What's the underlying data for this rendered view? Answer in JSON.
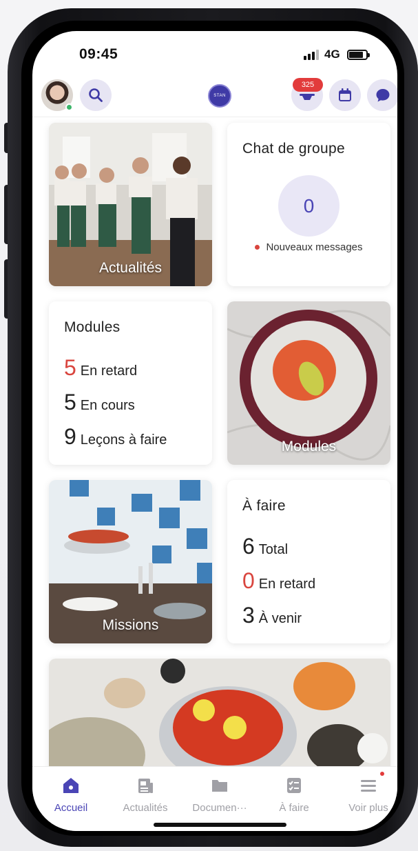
{
  "status_bar": {
    "time": "09:45",
    "network": "4G"
  },
  "header": {
    "notification_count": "325",
    "logo_text": "STAN"
  },
  "cards": {
    "news": {
      "caption": "Actualités"
    },
    "group_chat": {
      "title": "Chat de groupe",
      "count": "0",
      "note": "Nouveaux messages"
    },
    "modules_stats": {
      "title": "Modules",
      "rows": [
        {
          "value": "5",
          "label": "En retard"
        },
        {
          "value": "5",
          "label": "En cours"
        },
        {
          "value": "9",
          "label": "Leçons à faire"
        }
      ]
    },
    "modules_image": {
      "caption": "Modules"
    },
    "missions": {
      "caption": "Missions"
    },
    "todo": {
      "title": "À faire",
      "rows": [
        {
          "value": "6",
          "label": "Total"
        },
        {
          "value": "0",
          "label": "En retard"
        },
        {
          "value": "3",
          "label": "À venir"
        }
      ]
    }
  },
  "bottom_nav": {
    "items": [
      {
        "label": "Accueil",
        "icon": "home-icon"
      },
      {
        "label": "Actualités",
        "icon": "newspaper-icon"
      },
      {
        "label": "Documen···",
        "icon": "folder-icon"
      },
      {
        "label": "À faire",
        "icon": "checklist-icon"
      },
      {
        "label": "Voir plus",
        "icon": "menu-icon"
      }
    ]
  },
  "colors": {
    "accent": "#4a45b5",
    "alert": "#d9453e",
    "icon_bg": "#e7e5f3"
  }
}
